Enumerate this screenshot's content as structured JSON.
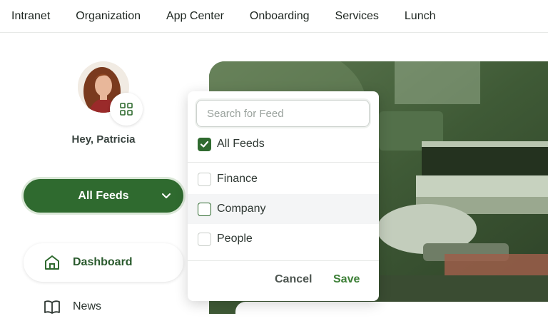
{
  "nav": {
    "items": [
      "Intranet",
      "Organization",
      "App Center",
      "Onboarding",
      "Services",
      "Lunch"
    ]
  },
  "profile": {
    "greeting": "Hey, Patricia",
    "avatar_icon": "apps-grid-icon"
  },
  "feed_selector": {
    "label": "All Feeds",
    "icon": "chevron-down-icon"
  },
  "sidebar": {
    "items": [
      {
        "label": "Dashboard",
        "icon": "home-icon",
        "active": true
      },
      {
        "label": "News",
        "icon": "book-icon",
        "active": false
      }
    ]
  },
  "dropdown": {
    "search_placeholder": "Search for Feed",
    "all_option": {
      "label": "All Feeds",
      "checked": true
    },
    "options": [
      {
        "label": "Finance",
        "checked": false
      },
      {
        "label": "Company",
        "checked": false,
        "hovered": true
      },
      {
        "label": "People",
        "checked": false
      }
    ],
    "cancel_label": "Cancel",
    "save_label": "Save"
  },
  "colors": {
    "accent": "#2f6a2f",
    "accent_light": "#dbe8d8",
    "save_text": "#3c7f36"
  }
}
